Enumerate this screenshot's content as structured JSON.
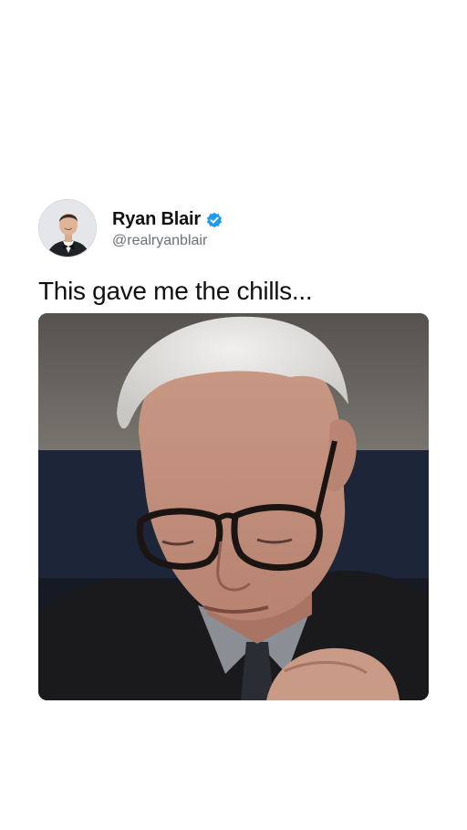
{
  "tweet": {
    "display_name": "Ryan Blair",
    "handle": "@realryanblair",
    "verified": true,
    "text": "This gave me the chills...",
    "avatar_icon": "profile-photo",
    "verified_icon": "verified-badge-icon",
    "media": {
      "type": "video-still"
    }
  },
  "colors": {
    "verified_blue": "#1d9bf0",
    "handle_gray": "#6b7177",
    "background": "#ffffff"
  }
}
